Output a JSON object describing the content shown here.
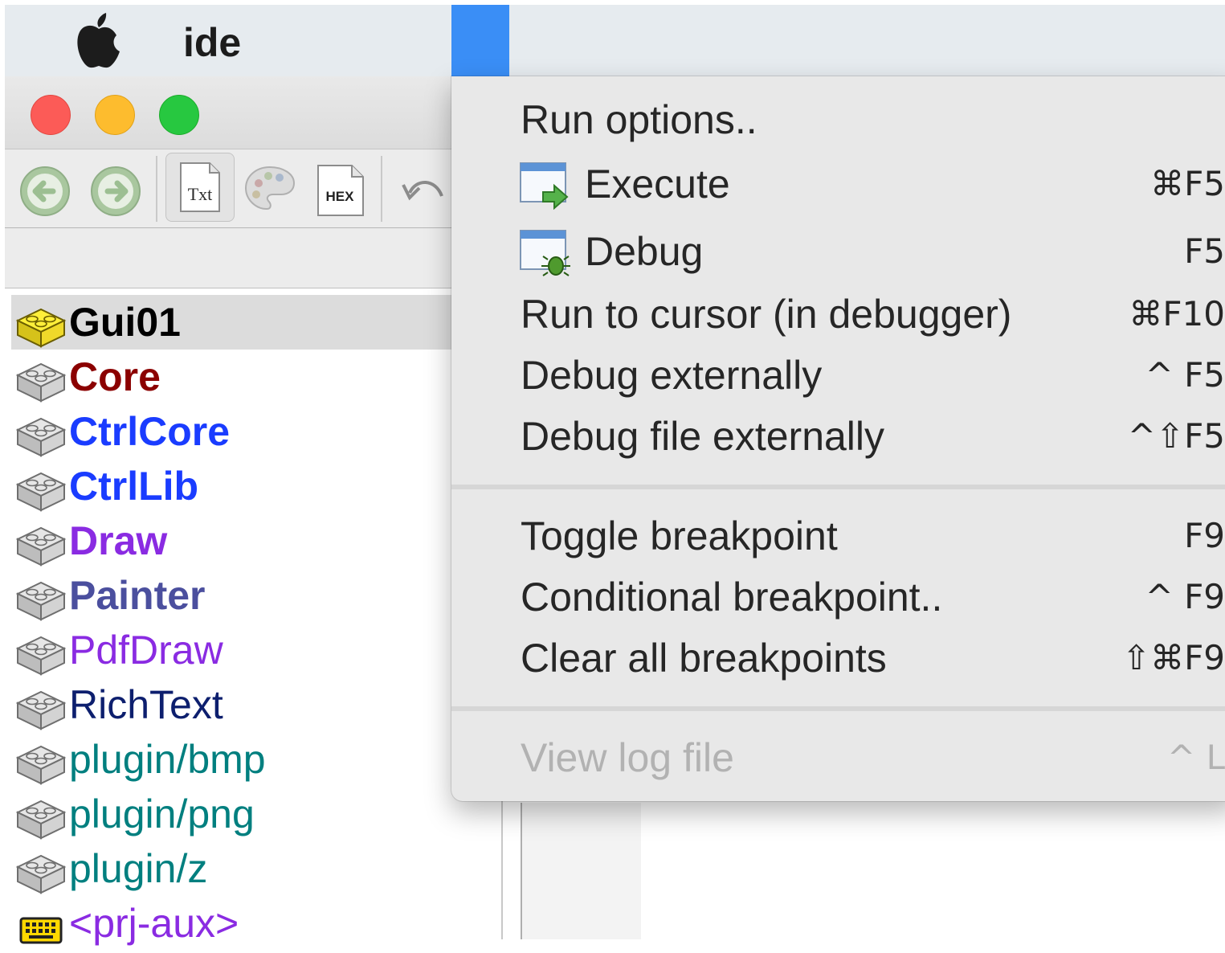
{
  "menubar": {
    "app_name": "ide",
    "apple_icon": "apple-logo-icon"
  },
  "toolbar": {
    "back_icon": "back-arrow-icon",
    "forward_icon": "forward-arrow-icon",
    "txt_label": "Txt",
    "palette_icon": "palette-icon",
    "hex_label": "HEX",
    "undo_icon": "undo-icon"
  },
  "packages": [
    {
      "label": "Gui01",
      "color": "#000000",
      "bold": true,
      "selected": true,
      "icon": "package-yellow-icon"
    },
    {
      "label": "Core",
      "color": "#8b0000",
      "bold": true,
      "icon": "package-icon"
    },
    {
      "label": "CtrlCore",
      "color": "#1a3cff",
      "bold": true,
      "icon": "package-icon"
    },
    {
      "label": "CtrlLib",
      "color": "#1a3cff",
      "bold": true,
      "icon": "package-icon"
    },
    {
      "label": "Draw",
      "color": "#8a2be2",
      "bold": true,
      "icon": "package-icon"
    },
    {
      "label": "Painter",
      "color": "#4b4f9e",
      "bold": true,
      "icon": "package-icon"
    },
    {
      "label": "PdfDraw",
      "color": "#8a2be2",
      "bold": false,
      "icon": "package-icon"
    },
    {
      "label": "RichText",
      "color": "#0d1f6e",
      "bold": false,
      "icon": "package-icon"
    },
    {
      "label": "plugin/bmp",
      "color": "#007f7f",
      "bold": false,
      "icon": "package-icon"
    },
    {
      "label": "plugin/png",
      "color": "#007f7f",
      "bold": false,
      "icon": "package-icon"
    },
    {
      "label": "plugin/z",
      "color": "#007f7f",
      "bold": false,
      "icon": "package-icon"
    },
    {
      "label": "<prj-aux>",
      "color": "#8a2be2",
      "bold": false,
      "icon": "keyboard-icon"
    }
  ],
  "menu": {
    "items": [
      {
        "label": "Run options..",
        "shortcut": ""
      },
      {
        "label": "Execute",
        "shortcut": "⌘F5",
        "icon": "execute-icon"
      },
      {
        "label": "Debug",
        "shortcut": "F5",
        "icon": "debug-bug-icon"
      },
      {
        "label": "Run to cursor (in debugger)",
        "shortcut": "⌘F10"
      },
      {
        "label": "Debug externally",
        "shortcut": "^ F5"
      },
      {
        "label": "Debug file externally",
        "shortcut": "^⇧F5"
      },
      {
        "label": "Toggle breakpoint",
        "shortcut": "F9"
      },
      {
        "label": "Conditional breakpoint..",
        "shortcut": "^ F9"
      },
      {
        "label": "Clear all breakpoints",
        "shortcut": "⇧⌘F9"
      },
      {
        "label": "View log file",
        "shortcut": "^ L",
        "disabled": true
      }
    ]
  },
  "colors": {
    "menubar_bg": "#e6ebef",
    "menu_highlight": "#3a8ef6",
    "menu_bg": "#e8e8e8",
    "traffic_close": "#fc5b57",
    "traffic_min": "#fdbc2e",
    "traffic_max": "#27c840"
  }
}
